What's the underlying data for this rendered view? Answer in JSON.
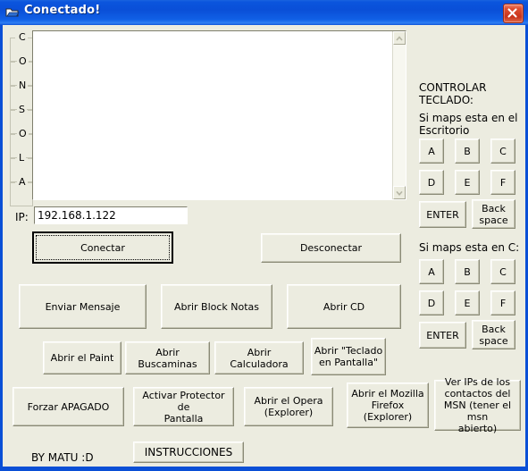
{
  "window": {
    "title": "Conectado!",
    "icon": "network-folder-icon",
    "close_label": "×",
    "accent_color": "#0a4fd6",
    "face_color": "#ECECE0"
  },
  "console": {
    "frame_letters": [
      "C",
      "O",
      "N",
      "S",
      "O",
      "L",
      "A"
    ],
    "text": "",
    "scrollbar": {
      "up_icon": "chevron-up-icon",
      "down_icon": "chevron-down-icon"
    }
  },
  "connection": {
    "ip_label": "IP:",
    "ip_value": "192.168.1.122",
    "ip_placeholder": "",
    "connect_label": "Conectar",
    "disconnect_label": "Desconectar"
  },
  "actions": {
    "row1": [
      {
        "label": "Enviar Mensaje",
        "name": "send-message-button"
      },
      {
        "label": "Abrir Block Notas",
        "name": "open-notepad-button"
      },
      {
        "label": "Abrir CD",
        "name": "open-cd-button"
      }
    ],
    "row2": [
      {
        "label": "Abrir el Paint",
        "name": "open-paint-button"
      },
      {
        "label": "Abrir Buscaminas",
        "name": "open-minesweeper-button"
      },
      {
        "label": "Abrir Calculadora",
        "name": "open-calculator-button"
      },
      {
        "label": "Abrir \"Teclado\nen Pantalla\"",
        "name": "open-onscreen-keyboard-button"
      }
    ],
    "row3": [
      {
        "label": "Forzar APAGADO",
        "name": "force-shutdown-button"
      },
      {
        "label": "Activar Protector de\nPantalla",
        "name": "activate-screensaver-button"
      },
      {
        "label": "Abrir el Opera\n(Explorer)",
        "name": "open-opera-button"
      },
      {
        "label": "Abrir el Mozilla\nFirefox\n(Explorer)",
        "name": "open-firefox-button"
      }
    ],
    "msn_label": "Ver IPs de los\ncontactos del\nMSN (tener el msn\nabierto)"
  },
  "keyboard": {
    "heading": "CONTROLAR\nTECLADO:",
    "section1_label": "Si maps esta en el\nEscritorio",
    "section2_label": "Si maps esta en C:",
    "keys": [
      "A",
      "B",
      "C",
      "D",
      "E",
      "F"
    ],
    "enter_label": "ENTER",
    "backspace_label": "Back\nspace"
  },
  "footer": {
    "credit": "BY MATU :D",
    "instructions_label": "INSTRUCCIONES"
  }
}
